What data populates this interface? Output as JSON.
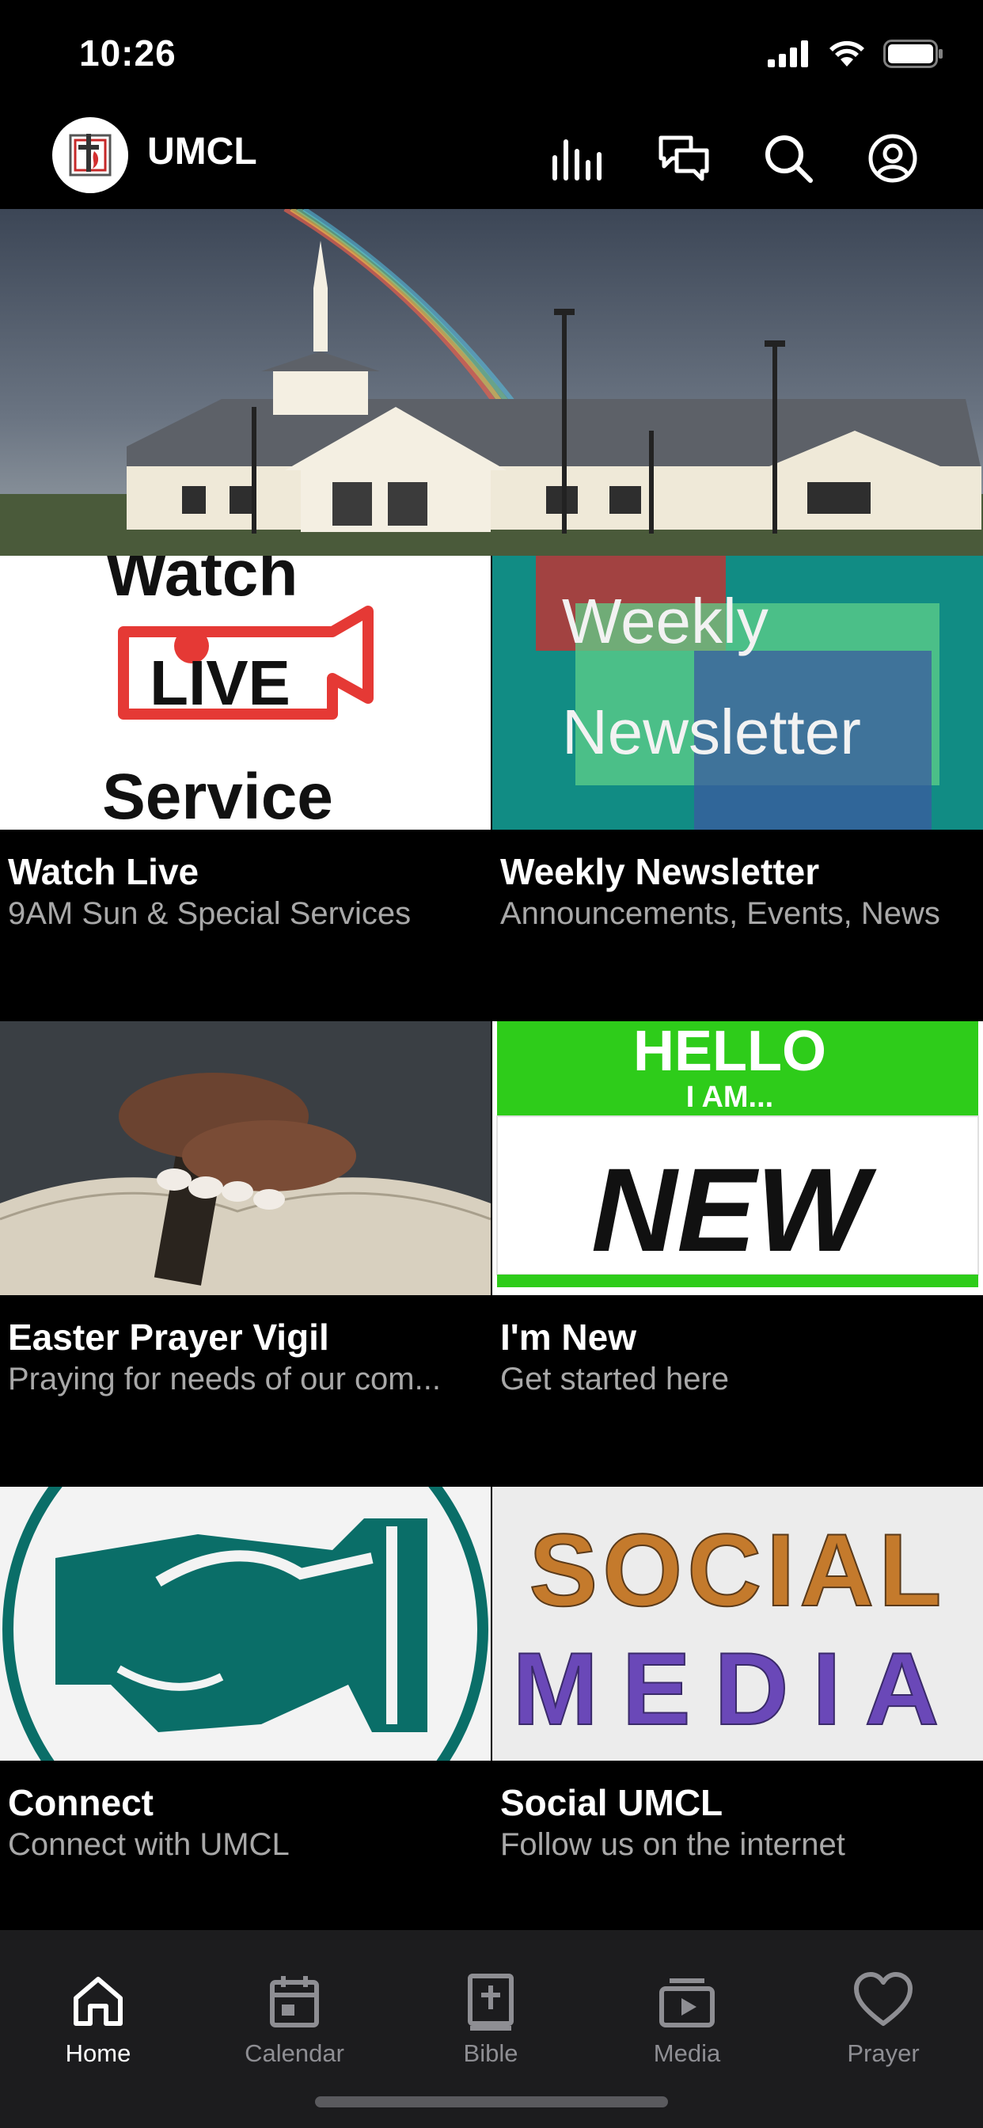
{
  "status": {
    "time": "10:26"
  },
  "header": {
    "title": "UMCL",
    "logo_text": "UMCL"
  },
  "hero": {
    "alt": "church-with-rainbow"
  },
  "tiles": [
    {
      "title": "Watch Live",
      "subtitle": "9AM Sun & Special Services",
      "image_text": {
        "top": "Watch",
        "middle": "LIVE",
        "bottom": "Service"
      }
    },
    {
      "title": "Weekly Newsletter",
      "subtitle": "Announcements, Events, News",
      "image_text": {
        "line1": "Weekly",
        "line2": "Newsletter"
      }
    },
    {
      "title": "Easter Prayer Vigil",
      "subtitle": "Praying for needs of our com..."
    },
    {
      "title": "I'm New",
      "subtitle": "Get started here",
      "image_text": {
        "line1": "HELLO",
        "line2": "I AM...",
        "line3": "NEW"
      }
    },
    {
      "title": "Connect",
      "subtitle": "Connect with UMCL"
    },
    {
      "title": "Social UMCL",
      "subtitle": "Follow us on the internet",
      "image_text": {
        "line1": "SOCIAL",
        "line2": "MEDIA"
      }
    }
  ],
  "tabs": [
    {
      "label": "Home",
      "icon": "home-icon",
      "active": true
    },
    {
      "label": "Calendar",
      "icon": "calendar-icon"
    },
    {
      "label": "Bible",
      "icon": "bible-icon"
    },
    {
      "label": "Media",
      "icon": "media-icon"
    },
    {
      "label": "Prayer",
      "icon": "heart-icon"
    }
  ],
  "colors": {
    "background": "#000000",
    "tabbar": "#1c1c1e",
    "inactive": "#8e8e93",
    "teal": "#0a6e68",
    "red": "#e53935",
    "green": "#2ecc1a"
  }
}
